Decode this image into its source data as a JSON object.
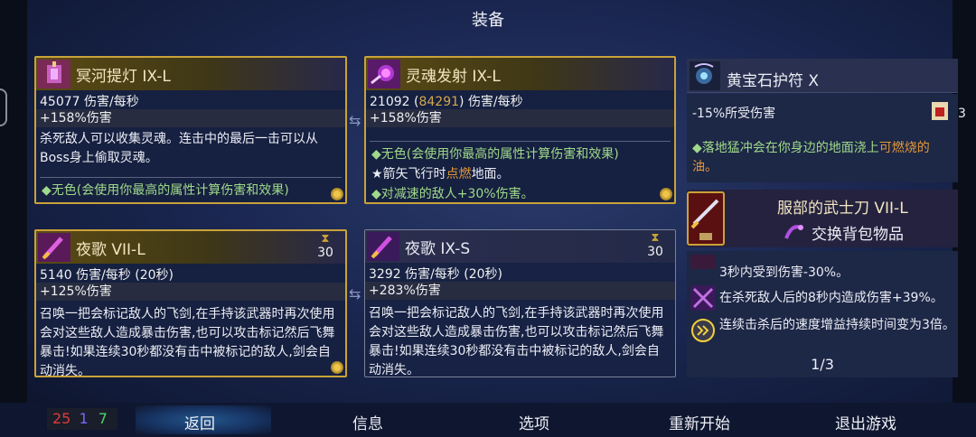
{
  "title": "装备",
  "weapons": [
    {
      "name": "冥河提灯 IX-L",
      "dps": "45077 伤害/每秒",
      "bonus": "+158%伤害",
      "desc": "杀死敌人可以收集灵魂。连击中的最后一击可以从Boss身上偷取灵魂。",
      "tags": [
        "◆无色(会使用你最高的属性计算伤害和效果)"
      ],
      "icon_name": "lantern-icon"
    },
    {
      "name": "灵魂发射 IX-L",
      "dps_a": "21092",
      "dps_b": "84291",
      "dps_unit": "伤害/每秒",
      "bonus": "+158%伤害",
      "tag1": "◆无色(会使用你最高的属性计算伤害和效果)",
      "tag2_prefix": "★箭矢飞行时",
      "tag2_hl": "点燃",
      "tag2_suffix": "地面。",
      "tag3": "◆对减速的敌人+30%伤害。",
      "icon_name": "soul-orb-icon"
    }
  ],
  "skills": [
    {
      "name": "夜歌 VII-L",
      "cooldown": "30",
      "dps": "5140 伤害/每秒 (20秒)",
      "bonus": "+125%伤害",
      "desc": "召唤一把会标记敌人的飞剑,在手持该武器时再次使用会对这些敌人造成暴击伤害,也可以攻击标记然后飞舞暴击!如果连续30秒都没有击中被标记的敌人,剑会自动消失。",
      "icon_name": "flying-sword-icon"
    },
    {
      "name": "夜歌 IX-S",
      "cooldown": "30",
      "dps": "3292 伤害/每秒 (20秒)",
      "bonus": "+283%伤害",
      "desc": "召唤一把会标记敌人的飞剑,在手持该武器时再次使用会对这些敌人造成暴击伤害,也可以攻击标记然后飞舞暴击!如果连续30秒都没有击中被标记的敌人,剑会自动消失。",
      "icon_name": "flying-sword-icon"
    }
  ],
  "amulet": {
    "name": "黄宝石护符 X",
    "effect": "-15%所受伤害",
    "count": "3",
    "line_prefix": "◆落地猛冲会在你身边的地面浇上",
    "line_hl": "可燃烧的",
    "line_suffix": "油。"
  },
  "backpack": {
    "name": "服部的武士刀 VII-L",
    "swap_label": "交换背包物品",
    "lines": [
      "3秒内受到伤害-30%。",
      "在杀死敌人后的8秒内造成伤害+39%。",
      "连续击杀后的速度增益持续时间变为3倍。"
    ],
    "page": "1/3"
  },
  "stats": {
    "brutality": "25",
    "tactics": "1",
    "survival": "7"
  },
  "colors": {
    "brutality": "#e03a3a",
    "tactics": "#7a66ff",
    "survival": "#49d36b",
    "gold": "#c9a23a"
  },
  "nav": {
    "back": "返回",
    "info": "信息",
    "options": "选项",
    "restart": "重新开始",
    "quit": "退出游戏"
  }
}
